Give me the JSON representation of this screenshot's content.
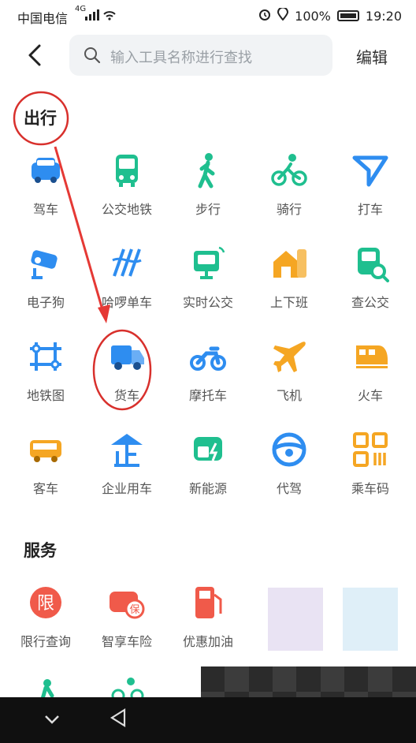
{
  "status": {
    "carrier": "中国电信",
    "network": "4G",
    "battery": "100%",
    "time": "19:20"
  },
  "header": {
    "search_placeholder": "输入工具名称进行查找",
    "edit_label": "编辑"
  },
  "sections": {
    "travel": {
      "title": "出行",
      "items": [
        {
          "label": "驾车",
          "icon": "car-icon",
          "color": "#2e8df0"
        },
        {
          "label": "公交地铁",
          "icon": "bus-icon",
          "color": "#1fbf8f"
        },
        {
          "label": "步行",
          "icon": "walk-icon",
          "color": "#1fbf8f"
        },
        {
          "label": "骑行",
          "icon": "bike-icon",
          "color": "#1fbf8f"
        },
        {
          "label": "打车",
          "icon": "taxi-icon",
          "color": "#2e8df0"
        },
        {
          "label": "电子狗",
          "icon": "camera-icon",
          "color": "#2e8df0"
        },
        {
          "label": "哈啰单车",
          "icon": "hello-bike-icon",
          "color": "#2e8df0"
        },
        {
          "label": "实时公交",
          "icon": "realtime-bus-icon",
          "color": "#1fbf8f"
        },
        {
          "label": "上下班",
          "icon": "commute-icon",
          "color": "#f5a623"
        },
        {
          "label": "查公交",
          "icon": "bus-search-icon",
          "color": "#1fbf8f"
        },
        {
          "label": "地铁图",
          "icon": "subway-map-icon",
          "color": "#2e8df0"
        },
        {
          "label": "货车",
          "icon": "truck-icon",
          "color": "#2e8df0"
        },
        {
          "label": "摩托车",
          "icon": "motorcycle-icon",
          "color": "#2e8df0"
        },
        {
          "label": "飞机",
          "icon": "plane-icon",
          "color": "#f5a623"
        },
        {
          "label": "火车",
          "icon": "train-icon",
          "color": "#f5a623"
        },
        {
          "label": "客车",
          "icon": "coach-icon",
          "color": "#f5a623"
        },
        {
          "label": "企业用车",
          "icon": "enterprise-car-icon",
          "color": "#2e8df0"
        },
        {
          "label": "新能源",
          "icon": "ev-icon",
          "color": "#1fbf8f"
        },
        {
          "label": "代驾",
          "icon": "steering-wheel-icon",
          "color": "#2e8df0"
        },
        {
          "label": "乘车码",
          "icon": "qr-code-icon",
          "color": "#f5a623"
        }
      ]
    },
    "service": {
      "title": "服务",
      "items": [
        {
          "label": "限行查询",
          "icon": "restriction-icon",
          "color": "#f05a4a",
          "glyph": "限"
        },
        {
          "label": "智享车险",
          "icon": "insurance-icon",
          "color": "#f05a4a",
          "glyph": "保"
        },
        {
          "label": "优惠加油",
          "icon": "fuel-icon",
          "color": "#f05a4a"
        }
      ]
    }
  },
  "accent_red": "#e53935"
}
